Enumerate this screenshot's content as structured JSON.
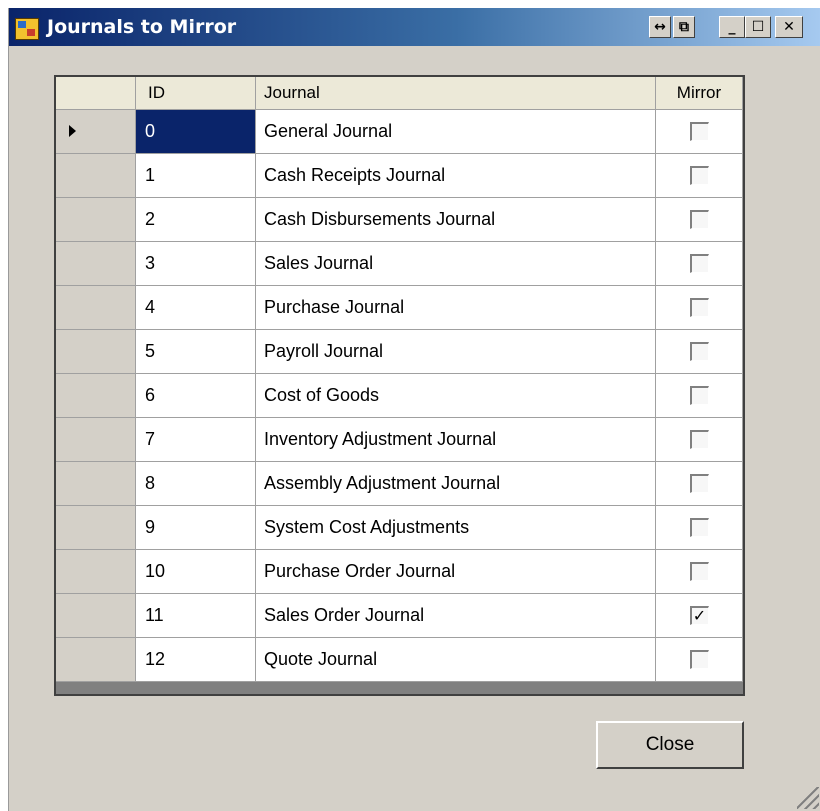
{
  "window": {
    "title": "Journals to Mirror",
    "buttons": {
      "pin": "↔",
      "restore_alt": "⧉",
      "minimize": "_",
      "maximize": "☐",
      "close": "✕"
    }
  },
  "grid": {
    "columns": {
      "id": "ID",
      "journal": "Journal",
      "mirror": "Mirror"
    },
    "selected_row": 0,
    "rows": [
      {
        "id": "0",
        "journal": "General Journal",
        "mirror": false
      },
      {
        "id": "1",
        "journal": "Cash Receipts Journal",
        "mirror": false
      },
      {
        "id": "2",
        "journal": "Cash Disbursements Journal",
        "mirror": false
      },
      {
        "id": "3",
        "journal": "Sales Journal",
        "mirror": false
      },
      {
        "id": "4",
        "journal": "Purchase Journal",
        "mirror": false
      },
      {
        "id": "5",
        "journal": "Payroll Journal",
        "mirror": false
      },
      {
        "id": "6",
        "journal": "Cost of Goods",
        "mirror": false
      },
      {
        "id": "7",
        "journal": "Inventory Adjustment Journal",
        "mirror": false
      },
      {
        "id": "8",
        "journal": "Assembly Adjustment Journal",
        "mirror": false
      },
      {
        "id": "9",
        "journal": "System Cost Adjustments",
        "mirror": false
      },
      {
        "id": "10",
        "journal": "Purchase Order Journal",
        "mirror": false
      },
      {
        "id": "11",
        "journal": "Sales Order Journal",
        "mirror": true
      },
      {
        "id": "12",
        "journal": "Quote Journal",
        "mirror": false
      }
    ]
  },
  "footer": {
    "close_label": "Close"
  },
  "colors": {
    "selection": "#0a246a",
    "dialog_bg": "#d4d0c8",
    "titlebar_start": "#0a246a"
  },
  "icons": {
    "row_indicator": "current-row-arrow-icon",
    "checked": "checkmark-icon"
  }
}
